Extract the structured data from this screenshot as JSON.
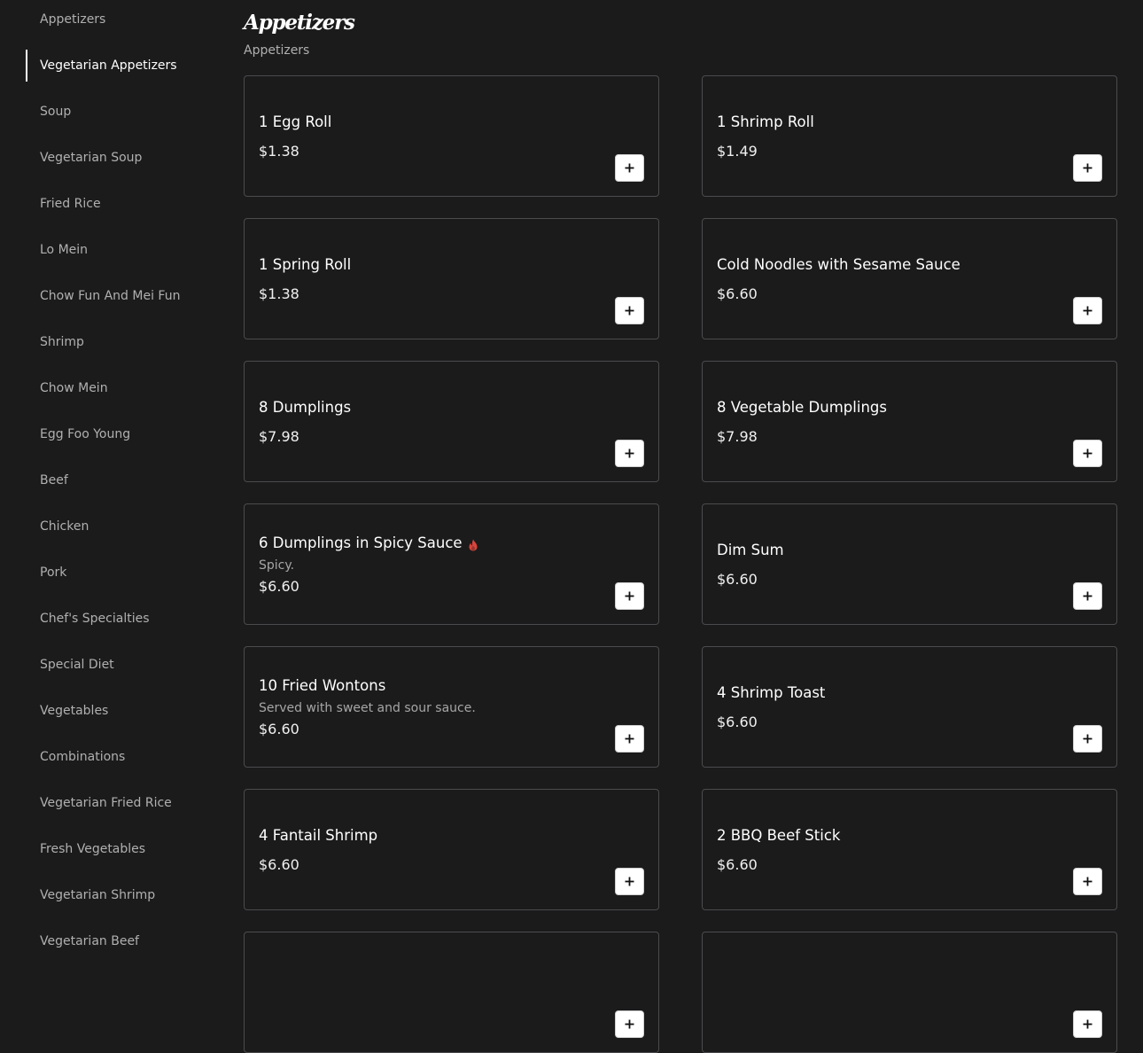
{
  "sidebar": {
    "items": [
      {
        "label": "Appetizers",
        "active": false
      },
      {
        "label": "Vegetarian Appetizers",
        "active": true
      },
      {
        "label": "Soup",
        "active": false
      },
      {
        "label": "Vegetarian Soup",
        "active": false
      },
      {
        "label": "Fried Rice",
        "active": false
      },
      {
        "label": "Lo Mein",
        "active": false
      },
      {
        "label": "Chow Fun And Mei Fun",
        "active": false
      },
      {
        "label": "Shrimp",
        "active": false
      },
      {
        "label": "Chow Mein",
        "active": false
      },
      {
        "label": "Egg Foo Young",
        "active": false
      },
      {
        "label": "Beef",
        "active": false
      },
      {
        "label": "Chicken",
        "active": false
      },
      {
        "label": "Pork",
        "active": false
      },
      {
        "label": "Chef's Specialties",
        "active": false
      },
      {
        "label": "Special Diet",
        "active": false
      },
      {
        "label": "Vegetables",
        "active": false
      },
      {
        "label": "Combinations",
        "active": false
      },
      {
        "label": "Vegetarian Fried Rice",
        "active": false
      },
      {
        "label": "Fresh Vegetables",
        "active": false
      },
      {
        "label": "Vegetarian Shrimp",
        "active": false
      },
      {
        "label": "Vegetarian Beef",
        "active": false
      }
    ]
  },
  "section": {
    "title": "Appetizers",
    "subtitle": "Appetizers"
  },
  "items": [
    {
      "name": "1 Egg Roll",
      "price": "$1.38"
    },
    {
      "name": "1 Shrimp Roll",
      "price": "$1.49"
    },
    {
      "name": "1 Spring Roll",
      "price": "$1.38"
    },
    {
      "name": "Cold Noodles with Sesame Sauce",
      "price": "$6.60"
    },
    {
      "name": "8 Dumplings",
      "price": "$7.98"
    },
    {
      "name": "8 Vegetable Dumplings",
      "price": "$7.98"
    },
    {
      "name": "6 Dumplings in Spicy Sauce",
      "description": "Spicy.",
      "price": "$6.60",
      "icon": "spicy-flame-icon"
    },
    {
      "name": "Dim Sum",
      "price": "$6.60"
    },
    {
      "name": "10 Fried Wontons",
      "description": "Served with sweet and sour sauce.",
      "price": "$6.60"
    },
    {
      "name": "4 Shrimp Toast",
      "price": "$6.60"
    },
    {
      "name": "4 Fantail Shrimp",
      "price": "$6.60"
    },
    {
      "name": "2 BBQ Beef Stick",
      "price": "$6.60"
    },
    {
      "name": "",
      "price": ""
    },
    {
      "name": "",
      "price": ""
    }
  ],
  "colors": {
    "background": "#1b1b1c",
    "card_border": "#4b4b4d",
    "spicy": "#d9453b",
    "add_button": "#ffffff"
  }
}
